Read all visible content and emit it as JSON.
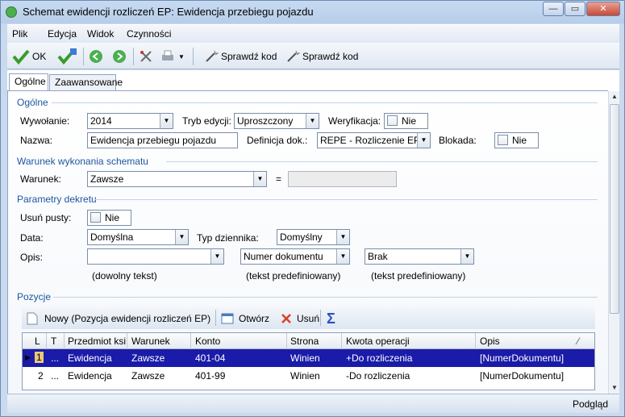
{
  "window": {
    "title": "Schemat ewidencji rozliczeń EP: Ewidencja przebiegu pojazdu"
  },
  "menu": [
    "Plik",
    "Edycja",
    "Widok",
    "Czynności"
  ],
  "toolbar": {
    "ok_label": "OK",
    "check_code_1": "Sprawdź kod",
    "check_code_2": "Sprawdź kod"
  },
  "tabs": [
    "Ogólne",
    "Zaawansowane"
  ],
  "general": {
    "section": "Ogólne",
    "wywolanie_label": "Wywołanie:",
    "wywolanie_value": "2014",
    "tryb_label": "Tryb edycji:",
    "tryb_value": "Uproszczony",
    "weryfikacja_label": "Weryfikacja:",
    "weryfikacja_value": "Nie",
    "nazwa_label": "Nazwa:",
    "nazwa_value": "Ewidencja przebiegu pojazdu",
    "definicja_label": "Definicja dok.:",
    "definicja_value": "REPE - Rozliczenie EP (ew",
    "blokada_label": "Blokada:",
    "blokada_value": "Nie"
  },
  "condition": {
    "section": "Warunek wykonania schematu",
    "warunek_label": "Warunek:",
    "warunek_value": "Zawsze",
    "equals": "="
  },
  "decree": {
    "section": "Parametry dekretu",
    "usun_label": "Usuń pusty:",
    "usun_value": "Nie",
    "data_label": "Data:",
    "data_value": "Domyślna",
    "typ_label": "Typ dziennika:",
    "typ_value": "Domyślny",
    "opis_label": "Opis:",
    "opis_value": "",
    "opis2_value": "Numer dokumentu",
    "opis3_value": "Brak",
    "hint1": "(dowolny tekst)",
    "hint2": "(tekst predefiniowany)",
    "hint3": "(tekst predefiniowany)"
  },
  "positions": {
    "section": "Pozycje",
    "new_label": "Nowy (Pozycja ewidencji rozliczeń EP)",
    "open_label": "Otwórz",
    "delete_label": "Usuń",
    "columns": [
      "L",
      "T",
      "Przedmiot ksi",
      "Warunek",
      "Konto",
      "Strona",
      "Kwota operacji",
      "Opis"
    ],
    "rows": [
      [
        "1",
        "...",
        "Ewidencja",
        "Zawsze",
        "401-04",
        "Winien",
        "+Do rozliczenia",
        "[NumerDokumentu]"
      ],
      [
        "2",
        "...",
        "Ewidencja",
        "Zawsze",
        "401-99",
        "Winien",
        "-Do rozliczenia",
        "[NumerDokumentu]"
      ]
    ]
  },
  "status": {
    "preview": "Podgląd"
  }
}
